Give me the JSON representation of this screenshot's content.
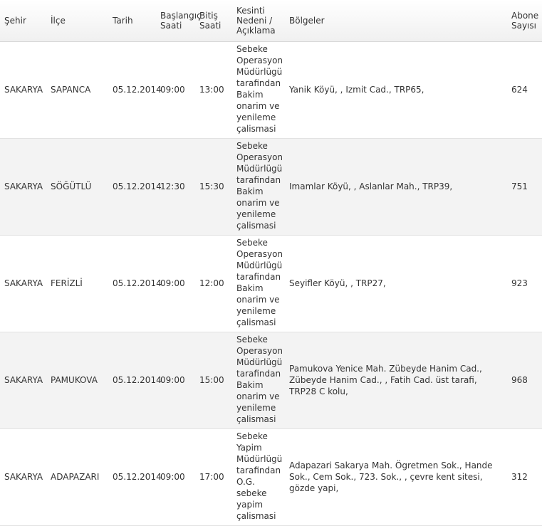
{
  "table": {
    "headers": {
      "city": "Şehir",
      "district": "İlçe",
      "date": "Tarih",
      "start": "Başlangıç\nSaati",
      "end": "Bitiş\nSaati",
      "reason": "Kesinti\nNedeni /\nAçıklama",
      "regions": "Bölgeler",
      "subscribers": "Abone\nSayısı"
    },
    "rows": [
      {
        "city": "SAKARYA",
        "district": "SAPANCA",
        "date": "05.12.2014",
        "start": "09:00",
        "end": "13:00",
        "reason": "Sebeke Operasyon Müdürlügü tarafindan Bakim onarim ve yenileme çalismasi",
        "regions": "Yanik Köyü, , Izmit Cad., TRP65,",
        "subscribers": "624"
      },
      {
        "city": "SAKARYA",
        "district": "SÖĞÜTLÜ",
        "date": "05.12.2014",
        "start": "12:30",
        "end": "15:30",
        "reason": "Sebeke Operasyon Müdürlügü tarafindan Bakim onarim ve yenileme çalismasi",
        "regions": "Imamlar Köyü, , Aslanlar Mah., TRP39,",
        "subscribers": "751"
      },
      {
        "city": "SAKARYA",
        "district": "FERİZLİ",
        "date": "05.12.2014",
        "start": "09:00",
        "end": "12:00",
        "reason": "Sebeke Operasyon Müdürlügü tarafindan Bakim onarim ve yenileme çalismasi",
        "regions": "Seyifler Köyü, , TRP27,",
        "subscribers": "923"
      },
      {
        "city": "SAKARYA",
        "district": "PAMUKOVA",
        "date": "05.12.2014",
        "start": "09:00",
        "end": "15:00",
        "reason": "Sebeke Operasyon Müdürlügü tarafindan Bakim onarim ve yenileme çalismasi",
        "regions": "Pamukova Yenice Mah. Zübeyde Hanim Cad., Zübeyde Hanim Cad., , Fatih Cad. üst tarafi, TRP28 C kolu,",
        "subscribers": "968"
      },
      {
        "city": "SAKARYA",
        "district": "ADAPAZARI",
        "date": "05.12.2014",
        "start": "09:00",
        "end": "17:00",
        "reason": "Sebeke Yapim Müdürlügü tarafindan O.G. sebeke yapim çalismasi",
        "regions": "Adapazari Sakarya Mah. Ögretmen Sok., Hande Sok., Cem Sok., 723. Sok., , çevre kent sitesi, gözde yapi,",
        "subscribers": "312"
      }
    ]
  }
}
